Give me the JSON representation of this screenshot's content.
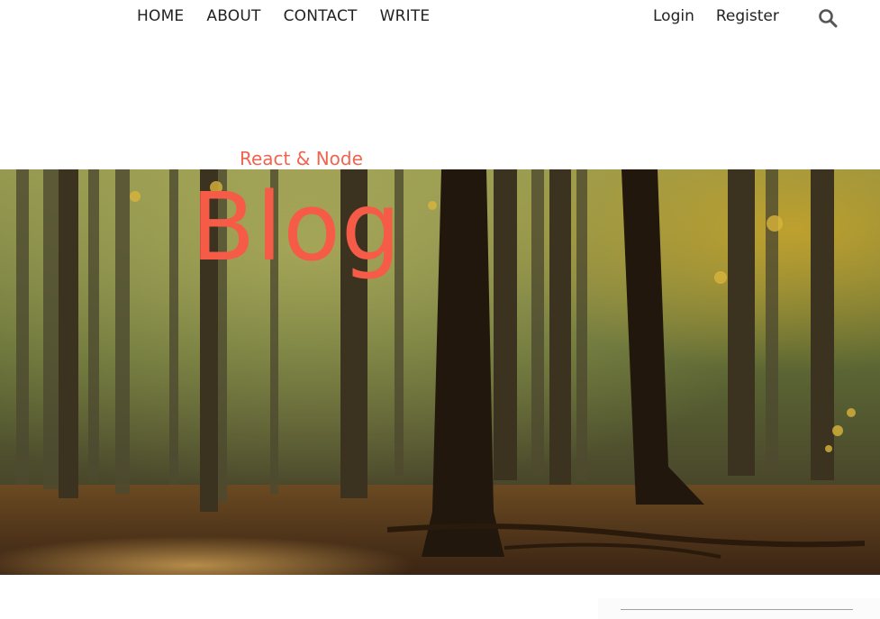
{
  "topbar": {
    "nav_left": [
      {
        "label": "HOME"
      },
      {
        "label": "ABOUT"
      },
      {
        "label": "CONTACT"
      },
      {
        "label": "WRITE"
      }
    ],
    "nav_right": [
      {
        "label": "Login"
      },
      {
        "label": "Register"
      }
    ],
    "search_icon": "search-icon"
  },
  "header": {
    "title_small": "React & Node",
    "title_large": "Blog",
    "hero_image": "forest-image"
  },
  "colors": {
    "accent": "#f55b47",
    "text": "#222222",
    "background": "#ffffff"
  }
}
